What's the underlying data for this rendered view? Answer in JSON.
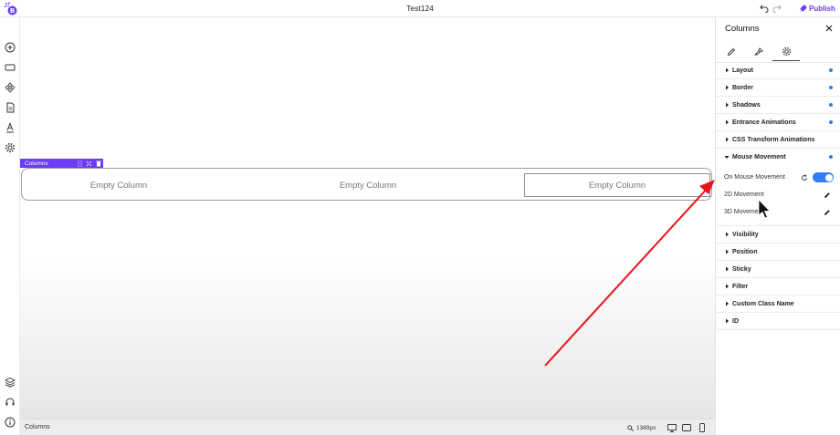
{
  "topbar": {
    "title": "Test124",
    "publish_label": "Publish",
    "logo_letter": "B"
  },
  "leftrail": {
    "icons": [
      "add-icon",
      "layout-icon",
      "components-icon",
      "pages-icon",
      "typography-icon",
      "settings-icon",
      "layers-icon",
      "support-icon",
      "info-icon"
    ]
  },
  "canvas": {
    "tag_label": "Columns",
    "columns": [
      "Empty Column",
      "Empty Column",
      "Empty Column"
    ]
  },
  "bottombar": {
    "breadcrumb": "Columns",
    "zoom": "1389px"
  },
  "panel": {
    "title": "Columns",
    "tabs": [
      "content-tab",
      "style-tab",
      "advanced-tab"
    ],
    "sections_top": [
      "Layout",
      "Border",
      "Shadows",
      "Entrance Animations",
      "CSS Transform Animations"
    ],
    "expanded_section": "Mouse Movement",
    "mouse_movement": {
      "on_label": "On Mouse Movement",
      "movement_2d": "2D Movement",
      "movement_3d": "3D Movement"
    },
    "sections_bottom": [
      "Visibility",
      "Position",
      "Sticky",
      "Filter",
      "Custom Class Name",
      "ID"
    ]
  },
  "colors": {
    "accent": "#6c3df4",
    "toggle": "#2f7df6",
    "annotation": "#e8141a"
  }
}
